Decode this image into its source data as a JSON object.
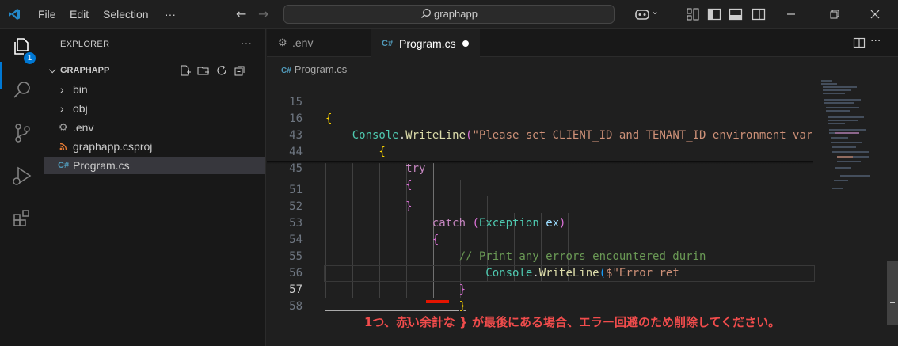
{
  "titlebar": {
    "menu": [
      "File",
      "Edit",
      "Selection",
      "···"
    ],
    "search_text": "graphapp",
    "copilot_caret": "⌄"
  },
  "activity_bar": {
    "items": [
      "explorer-icon",
      "search-icon",
      "source-control-icon",
      "run-debug-icon",
      "extensions-icon"
    ],
    "explorer_badge": "1"
  },
  "sidebar": {
    "title": "EXPLORER",
    "more": "···",
    "project": "GRAPHAPP",
    "items": [
      {
        "label": "bin",
        "icon": "chevron-right-icon"
      },
      {
        "label": "obj",
        "icon": "chevron-right-icon"
      },
      {
        "label": ".env",
        "icon": "gear-icon"
      },
      {
        "label": "graphapp.csproj",
        "icon": "rss-icon"
      },
      {
        "label": "Program.cs",
        "icon": "csharp-icon"
      }
    ]
  },
  "tabs": [
    {
      "label": ".env",
      "icon": "gear-icon",
      "active": false
    },
    {
      "label": "Program.cs",
      "icon": "csharp-icon",
      "active": true,
      "dirty": true
    }
  ],
  "breadcrumb": "Program.cs",
  "code_lines": [
    {
      "n": "15",
      "text": "{"
    },
    {
      "n": "16",
      "text": "    Console.WriteLine(\"Please set CLIENT_ID and TENANT_ID environment var"
    },
    {
      "n": "43",
      "text": "        {"
    },
    {
      "n": "44",
      "text": "            try"
    },
    {
      "n": "45",
      "text": "            {"
    },
    {
      "n": "51",
      "text": "            }"
    },
    {
      "n": "52",
      "text": "                catch (Exception ex)"
    },
    {
      "n": "53",
      "text": "                {"
    },
    {
      "n": "54",
      "text": "                    // Print any errors encountered durin"
    },
    {
      "n": "55",
      "text": "                        Console.WriteLine($\"Error ret"
    },
    {
      "n": "56",
      "text": "                    }"
    },
    {
      "n": "57",
      "text": "                    }"
    },
    {
      "n": "58",
      "text": "            }"
    }
  ],
  "annotation": "1つ、赤い余計な } が最後にある場合、エラー回避のため削除してください。",
  "colors": {
    "accent": "#0078d4",
    "annotation_red": "#f14c4c",
    "bracket_yellow": "#ffd700",
    "bracket_purple": "#da70d6",
    "bracket_blue": "#179fff"
  }
}
